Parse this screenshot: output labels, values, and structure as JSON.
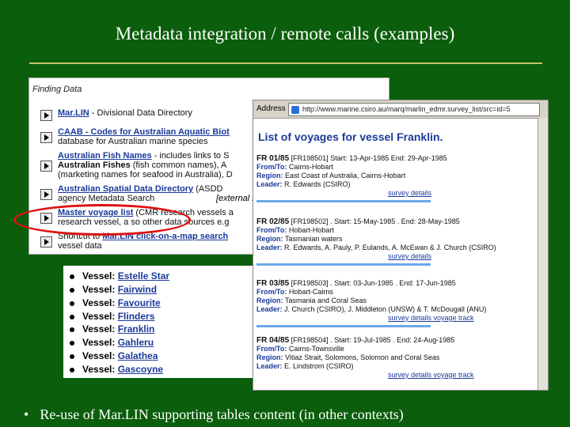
{
  "slide": {
    "title": "Metadata integration /  remote calls (examples)",
    "bullet_glyph": "•",
    "bullet_text": "Re-use of Mar.LIN supporting tables content (in other contexts)"
  },
  "finding": {
    "header": "Finding Data",
    "rows": [
      {
        "link": "Mar.LIN",
        "rest": " - Divisional Data Directory",
        "line2": ""
      },
      {
        "link": "CAAB - Codes for Australian Aquatic Biot",
        "rest": "",
        "line2": "database for Australian marine species"
      },
      {
        "link": "Australian Fish Names",
        "rest": " - includes links to S",
        "line2a": "Australian Fishes",
        "line2b": " (fish common names), A",
        "line3": "(marketing names for seafood in Australia), D"
      },
      {
        "link": "Australian Spatial Data Directory",
        "rest": " (ASDD",
        "line2": "agency Metadata Search"
      },
      {
        "link": "Master voyage list",
        "rest": " (CMR research vessels a",
        "line2": "research vessel, a so other data sources e.g"
      },
      {
        "pre": "Shortcut to ",
        "link": "Mar.LIN click-on-a-map search",
        "rest": "",
        "line2": "vessel data"
      }
    ],
    "external_link_text": "[external link]"
  },
  "vessels": {
    "label": "Vessel: ",
    "items": [
      "Estelle Star",
      "Fairwind",
      "Favourite",
      "Flinders",
      "Franklin",
      "Gahleru",
      "Galathea",
      "Gascoyne"
    ]
  },
  "browser": {
    "address_label": "Address",
    "url": "http://www.marine.csiro.au/marq/marlin_edmr.survey_list/src=id=5",
    "page_title": "List of voyages for vessel Franklin.",
    "voyages": [
      {
        "id": "FR 01/85",
        "ref": "[FR198501]",
        "dates": "  Start: 13-Apr-1985  End: 29-Apr-1985",
        "from_to": "Cairns-Hobart",
        "region": "East Coast of Australia, Cairns-Hobart",
        "leader": "R. Edwards (CSIRO)",
        "links": "survey details"
      },
      {
        "id": "FR 02/85",
        "ref": "[FR198502]",
        "dates": " . Start: 15-May-1985 . End: 28-May-1985",
        "from_to": "Hobart-Hobart",
        "region": "Tasmanian waters",
        "leader": "R. Edwards, A. Pauly, P. Eulands, A. McEwan & J. Church (CSIRO)",
        "links": "survey details"
      },
      {
        "id": "FR 03/85",
        "ref": "[FR198503]",
        "dates": " . Start: 03-Jun-1985 . End: 17-Jun-1985",
        "from_to": "Hobart-Cairns",
        "region": "Tasmania and Coral Seas",
        "leader": "J. Church (CSIRO), J. Middleton (UNSW) & T. McDougall (ANU)",
        "links": "survey details    voyage track"
      },
      {
        "id": "FR 04/85",
        "ref": "[FR198504]",
        "dates": " . Start: 19-Jul-1985 . End: 24-Aug-1985",
        "from_to": "Cairns-Townsville",
        "region": "Vitiaz Strait, Solomons, Solomon and Coral Seas",
        "leader": "E. Lindstrom (CSIRO)",
        "links": "survey details    voyage track"
      }
    ],
    "labels": {
      "from_to": "From/To: ",
      "region": "Region: ",
      "leader": "Leader: "
    }
  },
  "colors": {
    "background": "#0b5e0b",
    "link": "#1a3a9a",
    "highlight_oval": "#d11111",
    "title_rule": "#c9c36a"
  }
}
